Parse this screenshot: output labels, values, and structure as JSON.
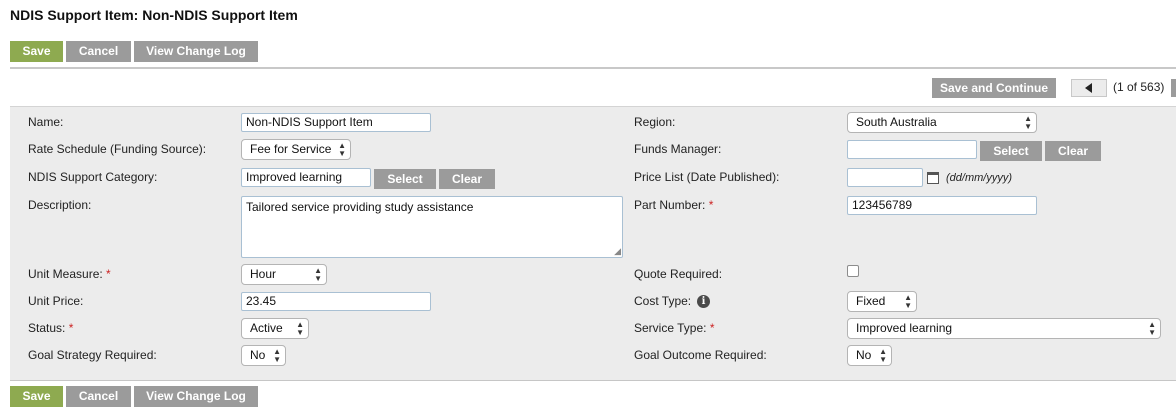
{
  "page": {
    "title": "NDIS Support Item: Non-NDIS Support Item"
  },
  "toolbar": {
    "save": "Save",
    "cancel": "Cancel",
    "change_log": "View Change Log"
  },
  "pager": {
    "save_continue": "Save and Continue",
    "position": "(1 of 563)"
  },
  "form": {
    "name": {
      "label": "Name:",
      "value": "Non-NDIS Support Item"
    },
    "rate_schedule": {
      "label": "Rate Schedule (Funding Source):",
      "value": "Fee for Service"
    },
    "support_category": {
      "label": "NDIS Support Category:",
      "value": "Improved learning",
      "select": "Select",
      "clear": "Clear"
    },
    "description": {
      "label": "Description:",
      "value": "Tailored service providing study assistance"
    },
    "unit_measure": {
      "label": "Unit Measure:",
      "required": "*",
      "value": "Hour"
    },
    "unit_price": {
      "label": "Unit Price:",
      "value": "23.45"
    },
    "status": {
      "label": "Status:",
      "required": "*",
      "value": "Active"
    },
    "goal_strategy": {
      "label": "Goal Strategy Required:",
      "value": "No"
    },
    "region": {
      "label": "Region:",
      "value": "South Australia"
    },
    "funds_manager": {
      "label": "Funds Manager:",
      "value": "",
      "select": "Select",
      "clear": "Clear"
    },
    "price_list": {
      "label": "Price List (Date Published):",
      "value": "",
      "hint": "(dd/mm/yyyy)"
    },
    "part_number": {
      "label": "Part Number:",
      "required": "*",
      "value": "123456789"
    },
    "quote_required": {
      "label": "Quote Required:",
      "checked": false
    },
    "cost_type": {
      "label": "Cost Type:",
      "value": "Fixed"
    },
    "service_type": {
      "label": "Service Type:",
      "required": "*",
      "value": "Improved learning"
    },
    "goal_outcome": {
      "label": "Goal Outcome Required:",
      "value": "No"
    }
  },
  "icons": {
    "info": "info-icon",
    "calendar": "calendar-icon",
    "prev": "triangle-left-icon"
  },
  "colors": {
    "save_green": "#8eaa50",
    "button_gray": "#9b9b9b",
    "panel_bg": "#ececec",
    "required_red": "#cc2222"
  }
}
